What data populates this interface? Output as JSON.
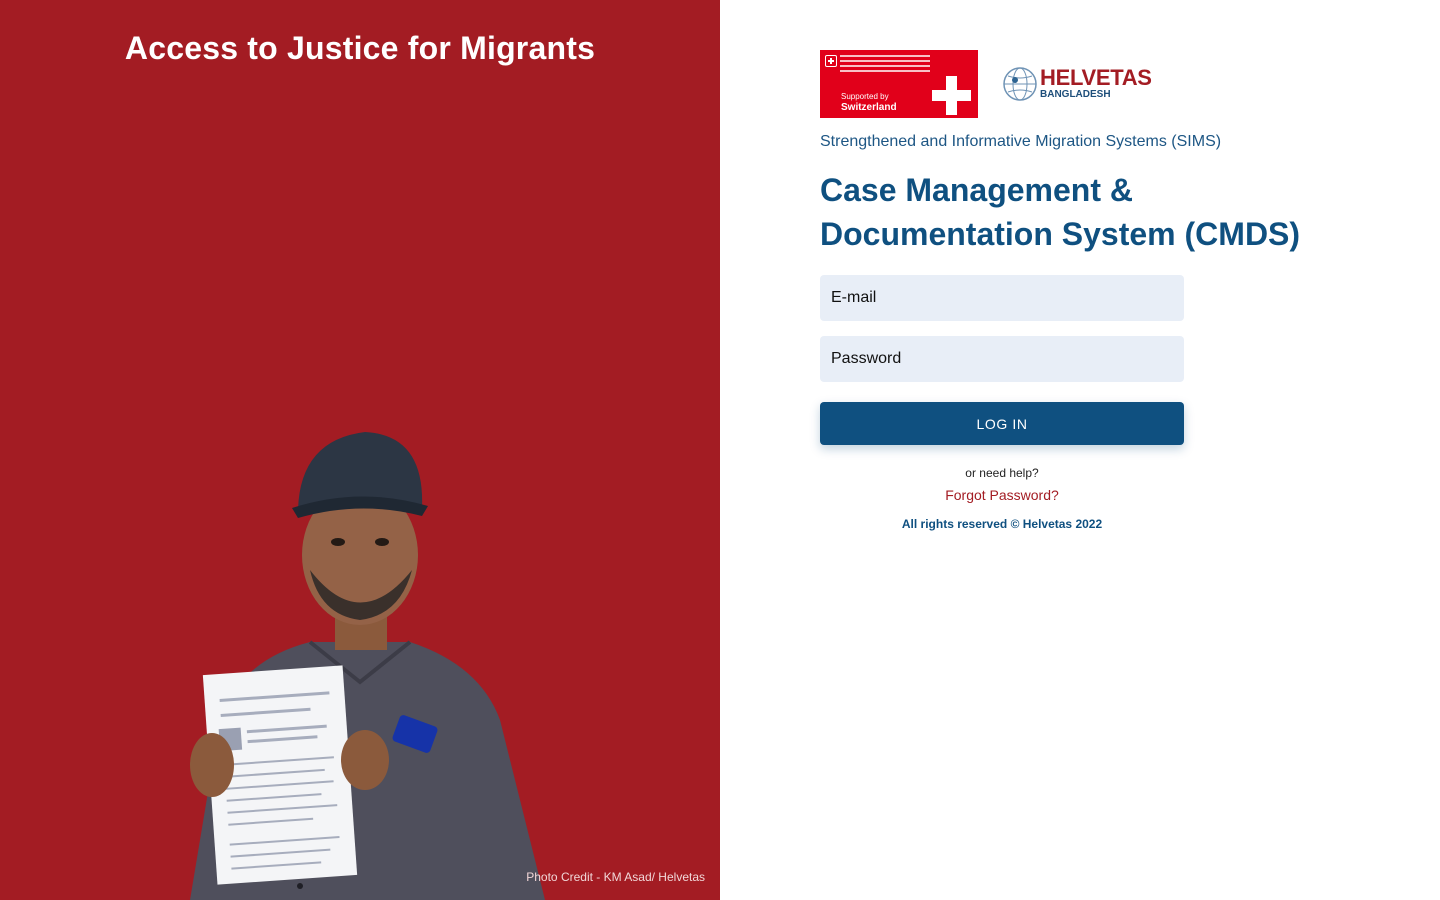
{
  "hero": {
    "title": "Access to Justice for Migrants",
    "photo_credit": "Photo Credit - KM Asad/ Helvetas"
  },
  "logos": {
    "swiss": {
      "supported_by": "Supported by",
      "country": "Switzerland"
    },
    "helvetas": {
      "name": "HELVETAS",
      "country": "BANGLADESH"
    }
  },
  "header": {
    "subtitle": "Strengthened and Informative Migration Systems (SIMS)",
    "title": "Case Management & Documentation System (CMDS)"
  },
  "form": {
    "email_placeholder": "E-mail",
    "password_placeholder": "Password",
    "login_label": "LOG IN",
    "help_text": "or need help?",
    "forgot_label": "Forgot Password?",
    "copyright": "All rights reserved © Helvetas 2022"
  },
  "colors": {
    "brand_red": "#a31c23",
    "brand_blue": "#0f5080",
    "swiss_red": "#e1001a",
    "input_bg": "#e8eef7"
  }
}
